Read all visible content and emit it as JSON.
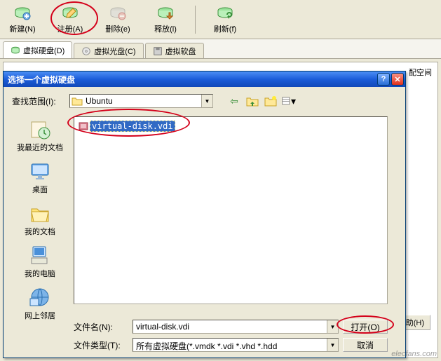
{
  "toolbar": {
    "new_label": "新建(N)",
    "register_label": "注册(A)",
    "delete_label": "删除(e)",
    "release_label": "释放(l)",
    "refresh_label": "刷新(f)"
  },
  "tabs": [
    {
      "label": "虚拟硬盘(D)",
      "active": true
    },
    {
      "label": "虚拟光盘(C)"
    },
    {
      "label": "虚拟软盘"
    }
  ],
  "side_panel": {
    "column_header": "配空间",
    "help_label": "帮助(H)"
  },
  "dialog": {
    "title": "选择一个虚拟硬盘",
    "lookin_label": "查找范围(I):",
    "lookin_value": "Ubuntu",
    "places": [
      {
        "id": "recent",
        "label": "我最近的文档"
      },
      {
        "id": "desktop",
        "label": "桌面"
      },
      {
        "id": "mydocs",
        "label": "我的文档"
      },
      {
        "id": "mycomputer",
        "label": "我的电脑"
      },
      {
        "id": "network",
        "label": "网上邻居"
      }
    ],
    "files": [
      {
        "name": "virtual-disk.vdi",
        "selected": true
      }
    ],
    "filename_label": "文件名(N):",
    "filename_value": "virtual-disk.vdi",
    "filetype_label": "文件类型(T):",
    "filetype_value": "所有虚拟硬盘(*.vmdk *.vdi *.vhd *.hdd",
    "open_label": "打开(O)",
    "cancel_label": "取消"
  },
  "watermark": "elecfans.com"
}
